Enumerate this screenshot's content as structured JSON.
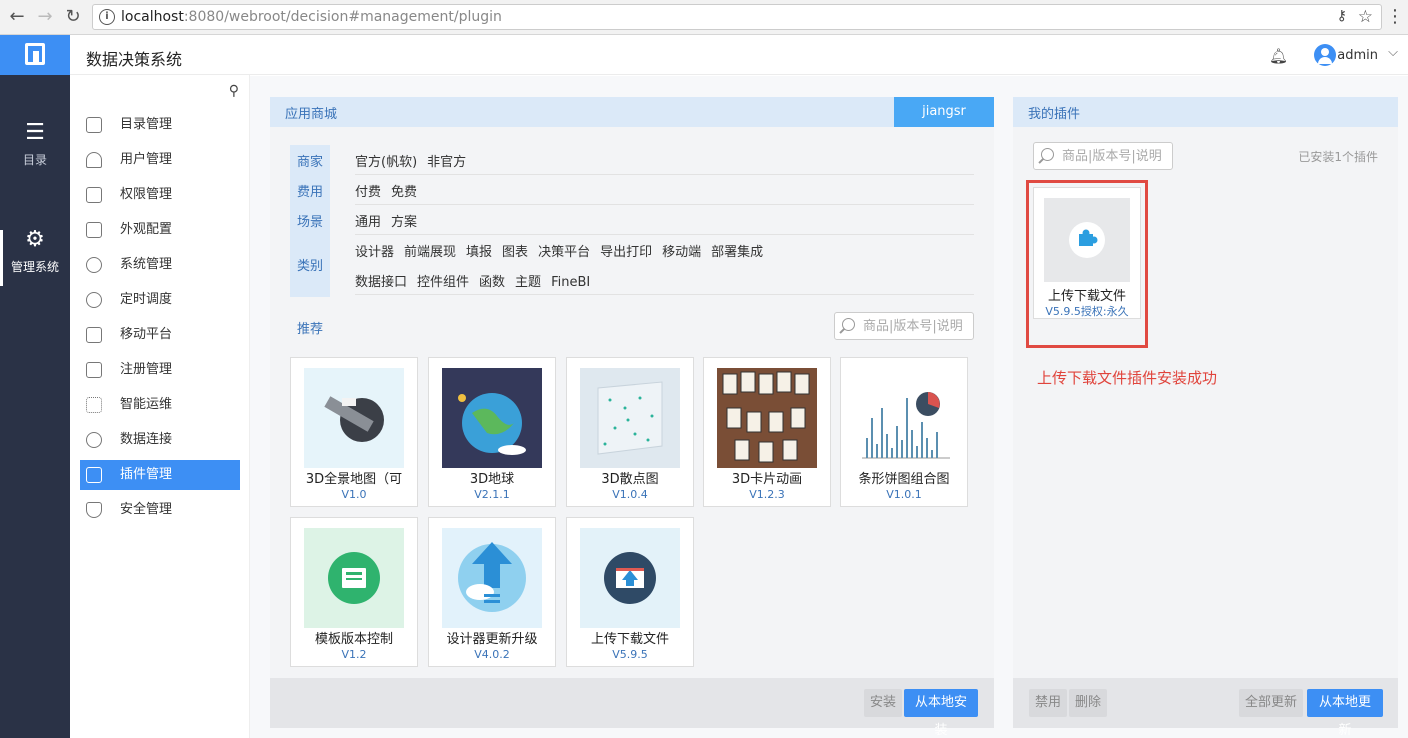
{
  "browser": {
    "url_host": "localhost",
    "url_rest": ":8080/webroot/decision#management/plugin"
  },
  "rail": {
    "items": [
      {
        "label": "目录",
        "icon": "list-icon"
      },
      {
        "label": "管理系统",
        "icon": "gear-icon"
      }
    ]
  },
  "header": {
    "title": "数据决策系统",
    "user": "admin"
  },
  "submenu": {
    "items": [
      {
        "label": "目录管理",
        "icon": "catalog-icon"
      },
      {
        "label": "用户管理",
        "icon": "user-icon"
      },
      {
        "label": "权限管理",
        "icon": "lock-icon"
      },
      {
        "label": "外观配置",
        "icon": "paint-icon"
      },
      {
        "label": "系统管理",
        "icon": "settings-icon"
      },
      {
        "label": "定时调度",
        "icon": "timer-icon"
      },
      {
        "label": "移动平台",
        "icon": "mobile-icon"
      },
      {
        "label": "注册管理",
        "icon": "register-icon"
      },
      {
        "label": "智能运维",
        "icon": "ops-icon"
      },
      {
        "label": "数据连接",
        "icon": "link-icon"
      },
      {
        "label": "插件管理",
        "icon": "plugin-icon"
      },
      {
        "label": "安全管理",
        "icon": "shield-icon"
      }
    ],
    "active_index": 10
  },
  "store": {
    "title": "应用商城",
    "account": "jiangsr",
    "filters": {
      "vendor": {
        "label": "商家",
        "options": [
          "官方(帆软)",
          "非官方"
        ]
      },
      "cost": {
        "label": "费用",
        "options": [
          "付费",
          "免费"
        ]
      },
      "scene": {
        "label": "场景",
        "options": [
          "通用",
          "方案"
        ]
      },
      "category": {
        "label": "类别",
        "options_row1": [
          "设计器",
          "前端展现",
          "填报",
          "图表",
          "决策平台",
          "导出打印",
          "移动端",
          "部署集成"
        ],
        "options_row2": [
          "数据接口",
          "控件组件",
          "函数",
          "主题",
          "FineBI"
        ]
      }
    },
    "recommend_label": "推荐",
    "search_placeholder": "商品|版本号|说明",
    "plugins": [
      {
        "name": "3D全景地图（可",
        "version": "V1.0"
      },
      {
        "name": "3D地球",
        "version": "V2.1.1"
      },
      {
        "name": "3D散点图",
        "version": "V1.0.4"
      },
      {
        "name": "3D卡片动画",
        "version": "V1.2.3"
      },
      {
        "name": "条形饼图组合图",
        "version": "V1.0.1"
      },
      {
        "name": "模板版本控制",
        "version": "V1.2"
      },
      {
        "name": "设计器更新升级",
        "version": "V4.0.2"
      },
      {
        "name": "上传下载文件",
        "version": "V5.9.5"
      }
    ],
    "buttons": {
      "install": "安装",
      "install_local": "从本地安装"
    }
  },
  "mine": {
    "title": "我的插件",
    "search_placeholder": "商品|版本号|说明",
    "installed_count": "已安装1个插件",
    "plugin": {
      "name": "上传下载文件",
      "version": "V5.9.5授权:永久"
    },
    "success_note": "上传下载文件插件安装成功",
    "buttons": {
      "disable": "禁用",
      "delete": "删除",
      "update_all": "全部更新",
      "update_local": "从本地更新"
    }
  }
}
